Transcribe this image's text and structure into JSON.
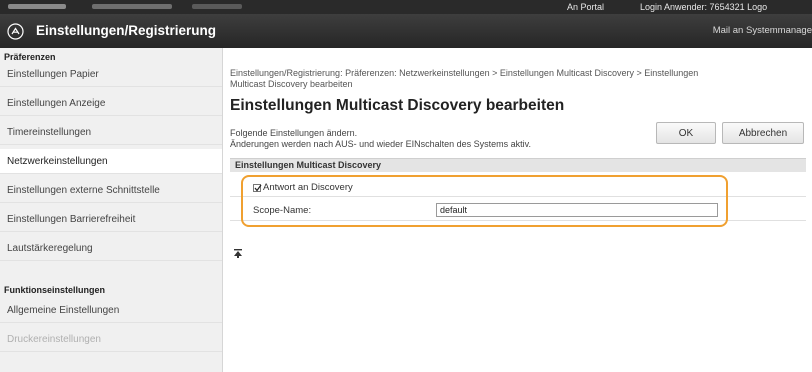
{
  "topbar": {
    "portal_label": "An Portal",
    "login_text": "Login Anwender:  7654321  Logo"
  },
  "header": {
    "title": "Einstellungen/Registrierung",
    "mail_text": "Mail an Systemmanage",
    "logo_icon": "settings-registration-icon"
  },
  "sidebar": {
    "section1_title": "Präferenzen",
    "items": [
      {
        "label": "Einstellungen Papier"
      },
      {
        "label": "Einstellungen Anzeige"
      },
      {
        "label": "Timereinstellungen"
      },
      {
        "label": "Netzwerkeinstellungen"
      },
      {
        "label": "Einstellungen externe Schnittstelle"
      },
      {
        "label": "Einstellungen Barrierefreiheit"
      },
      {
        "label": "Lautstärkeregelung"
      }
    ],
    "section2_title": "Funktionseinstellungen",
    "items2": [
      {
        "label": "Allgemeine Einstellungen"
      },
      {
        "label": "Druckereinstellungen"
      }
    ]
  },
  "main": {
    "breadcrumb_line1": "Einstellungen/Registrierung: Präferenzen: Netzwerkeinstellungen > Einstellungen Multicast Discovery > Einstellungen",
    "breadcrumb_line2": "Multicast Discovery bearbeiten",
    "page_title": "Einstellungen Multicast Discovery bearbeiten",
    "desc_line1": "Folgende Einstellungen ändern.",
    "desc_line2": "Änderungen werden nach AUS- und wieder EINschalten des Systems aktiv.",
    "ok_label": "OK",
    "cancel_label": "Abbrechen",
    "section_title": "Einstellungen Multicast Discovery",
    "checkbox_label": "Antwort an Discovery",
    "checkbox_checked": true,
    "scope_label": "Scope-Name:",
    "scope_value": "default",
    "to_top_icon": "back-to-top-icon"
  },
  "colors": {
    "highlight": "#f0a030",
    "header_bg": "#2e2e2e"
  }
}
